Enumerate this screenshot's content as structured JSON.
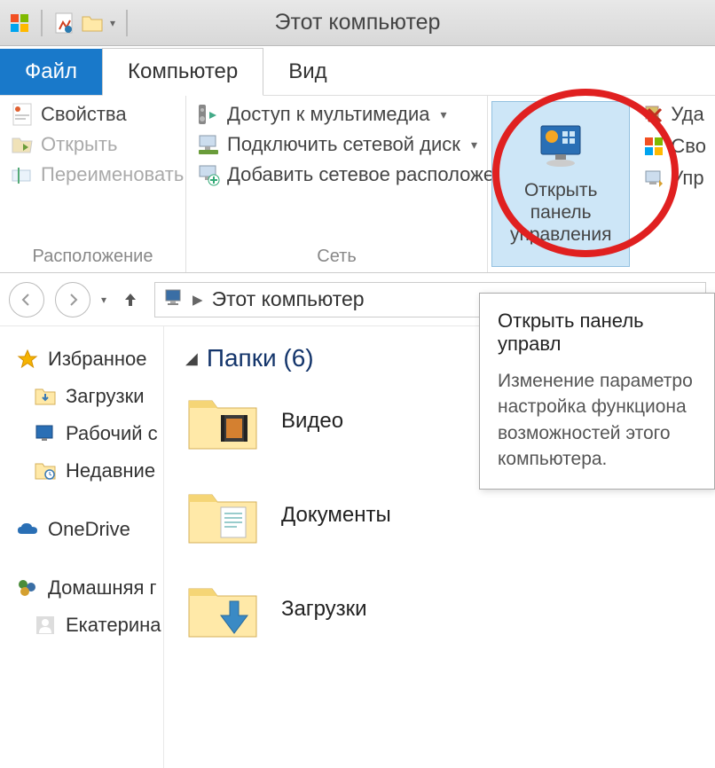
{
  "window": {
    "title": "Этот компьютер"
  },
  "tabs": {
    "file": "Файл",
    "computer": "Компьютер",
    "view": "Вид"
  },
  "ribbon": {
    "location": {
      "label": "Расположение",
      "properties": "Свойства",
      "open": "Открыть",
      "rename": "Переименовать"
    },
    "network": {
      "label": "Сеть",
      "media": "Доступ к мультимедиа",
      "map_drive": "Подключить сетевой диск",
      "add_location": "Добавить сетевое расположение"
    },
    "system": {
      "open_cp_line1": "Открыть панель",
      "open_cp_line2": "управления",
      "remove": "Уда",
      "props_sys": "Сво",
      "manage": "Упр"
    }
  },
  "nav": {
    "breadcrumb": "Этот компьютер"
  },
  "tooltip": {
    "title": "Открыть панель управл",
    "body": "Изменение параметро настройка функциона возможностей этого компьютера."
  },
  "sidebar": {
    "favorites": "Избранное",
    "downloads": "Загрузки",
    "desktop": "Рабочий с",
    "recent": "Недавние",
    "onedrive": "OneDrive",
    "homegroup": "Домашняя г",
    "user": "Екатерина"
  },
  "main": {
    "folders_header": "Папки (6)",
    "items": {
      "video": "Видео",
      "documents": "Документы",
      "downloads": "Загрузки"
    }
  }
}
